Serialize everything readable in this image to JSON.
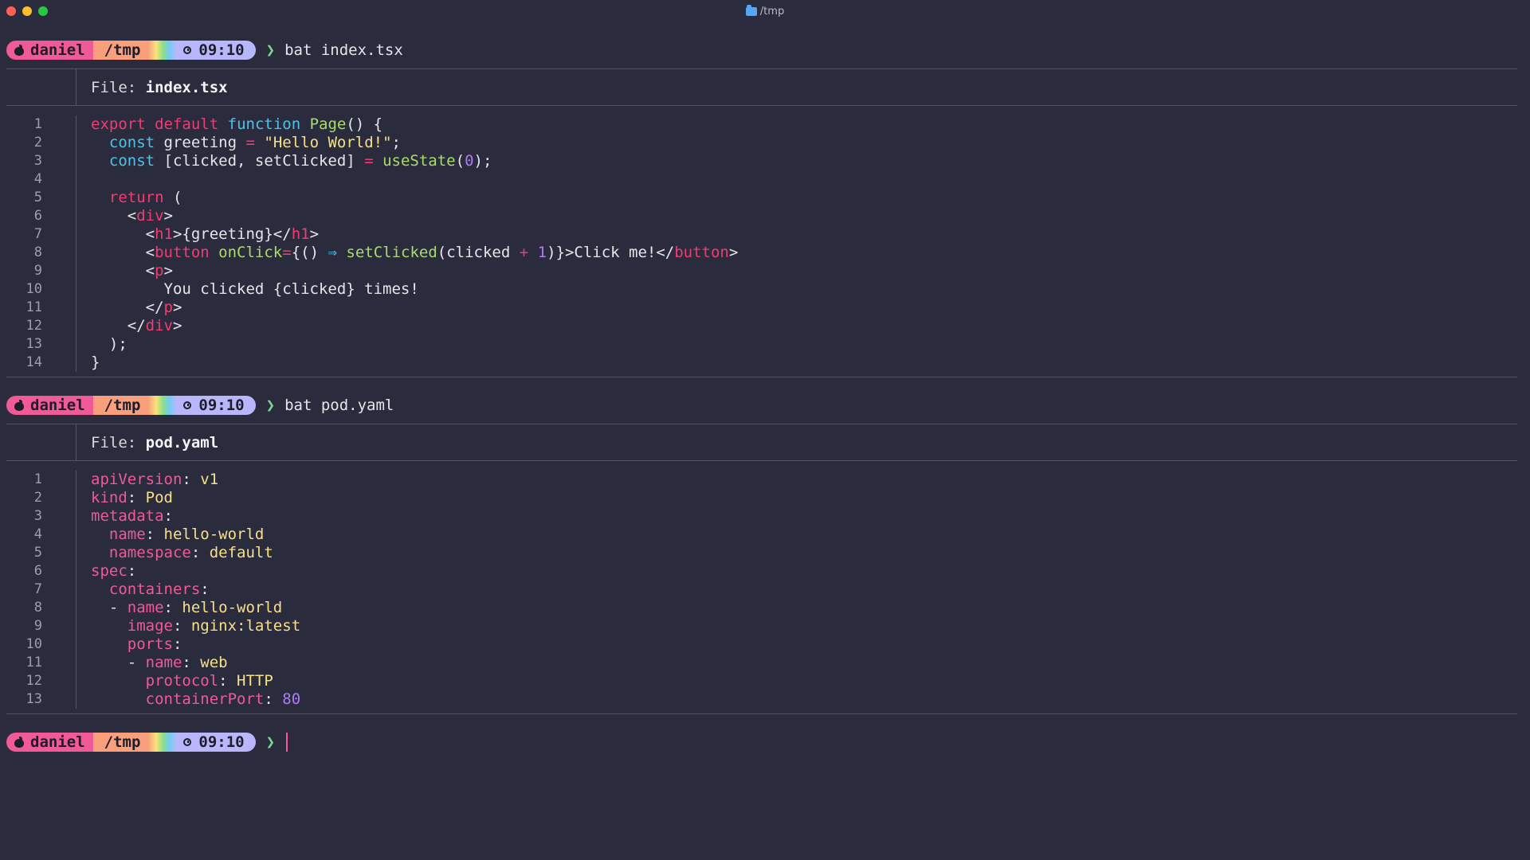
{
  "window": {
    "title": "/tmp",
    "accent_colors": {
      "red": "#ff5f57",
      "yellow": "#febc2e",
      "green": "#28c840"
    },
    "icons": [
      "close-icon",
      "minimize-icon",
      "zoom-icon",
      "folder-icon"
    ]
  },
  "prompt": {
    "user": "daniel",
    "dir": "/tmp",
    "time": "09:10",
    "symbol": "❯"
  },
  "blocks": [
    {
      "command": "bat index.tsx",
      "file_label": "File: ",
      "file_name": "index.tsx",
      "line_numbers": [
        "1",
        "2",
        "3",
        "4",
        "5",
        "6",
        "7",
        "8",
        "9",
        "10",
        "11",
        "12",
        "13",
        "14"
      ]
    },
    {
      "command": "bat pod.yaml",
      "file_label": "File: ",
      "file_name": "pod.yaml",
      "line_numbers": [
        "1",
        "2",
        "3",
        "4",
        "5",
        "6",
        "7",
        "8",
        "9",
        "10",
        "11",
        "12",
        "13"
      ]
    }
  ],
  "tsx_tokens": {
    "l1": [
      "export",
      " ",
      "default",
      " ",
      "function",
      " ",
      "Page",
      "() {"
    ],
    "l2": [
      "  ",
      "const",
      " greeting ",
      "=",
      " ",
      "\"Hello World!\"",
      ";"
    ],
    "l3": [
      "  ",
      "const",
      " [clicked, setClicked] ",
      "=",
      " ",
      "useState",
      "(",
      "0",
      ");"
    ],
    "l5": [
      "  ",
      "return",
      " ("
    ],
    "l6": [
      "    <",
      "div",
      ">"
    ],
    "l7": [
      "      <",
      "h1",
      ">{greeting}</",
      "h1",
      ">"
    ],
    "l8": [
      "      <",
      "button",
      " ",
      "onClick",
      "=",
      "{() ",
      "⇒",
      " ",
      "setClicked",
      "(clicked ",
      "+",
      " ",
      "1",
      ")}>Click me!</",
      "button",
      ">"
    ],
    "l9": [
      "      <",
      "p",
      ">"
    ],
    "l10": [
      "        You clicked {clicked} times!"
    ],
    "l11": [
      "      </",
      "p",
      ">"
    ],
    "l12": [
      "    </",
      "div",
      ">"
    ],
    "l13": [
      "  );"
    ],
    "l14": [
      "}"
    ]
  },
  "yaml_tokens": {
    "l1": [
      "apiVersion",
      ": ",
      "v1"
    ],
    "l2": [
      "kind",
      ": ",
      "Pod"
    ],
    "l3": [
      "metadata",
      ":"
    ],
    "l4": [
      "  ",
      "name",
      ": ",
      "hello-world"
    ],
    "l5": [
      "  ",
      "namespace",
      ": ",
      "default"
    ],
    "l6": [
      "spec",
      ":"
    ],
    "l7": [
      "  ",
      "containers",
      ":"
    ],
    "l8": [
      "  - ",
      "name",
      ": ",
      "hello-world"
    ],
    "l9": [
      "    ",
      "image",
      ": ",
      "nginx:latest"
    ],
    "l10": [
      "    ",
      "ports",
      ":"
    ],
    "l11": [
      "    - ",
      "name",
      ": ",
      "web"
    ],
    "l12": [
      "      ",
      "protocol",
      ": ",
      "HTTP"
    ],
    "l13": [
      "      ",
      "containerPort",
      ": ",
      "80"
    ]
  }
}
